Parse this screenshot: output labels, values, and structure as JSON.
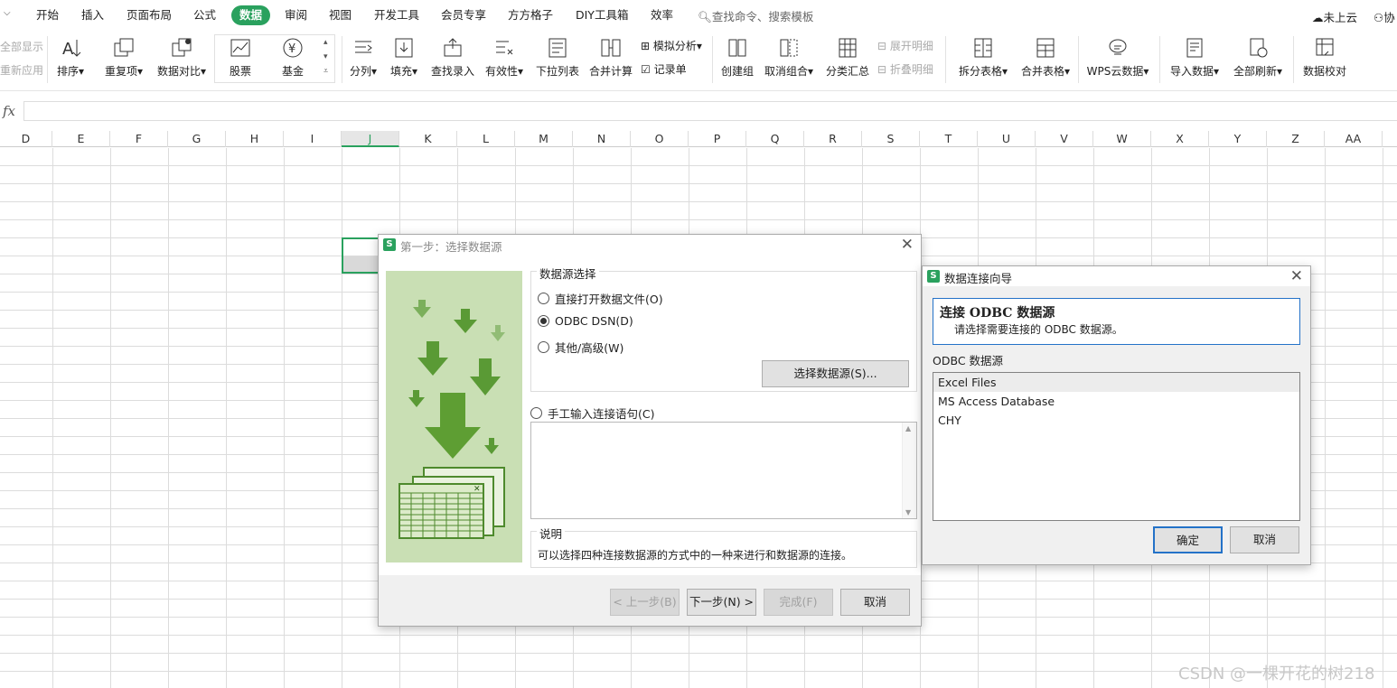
{
  "menu": {
    "tabs": [
      "开始",
      "插入",
      "页面布局",
      "公式",
      "数据",
      "审阅",
      "视图",
      "开发工具",
      "会员专享",
      "方方格子",
      "DIY工具箱",
      "效率"
    ],
    "active_tab": "数据",
    "search_placeholder": "查找命令、搜索模板",
    "cloud_label": "未上云",
    "collab_label": "协"
  },
  "ribbon": {
    "show_all": "全部显示",
    "reapply": "重新应用",
    "sort": "排序",
    "duplicates": "重复项",
    "compare": "数据对比",
    "stock": "股票",
    "fund": "基金",
    "split": "分列",
    "fill": "填充",
    "lookup": "查找录入",
    "validity": "有效性",
    "dropdown": "下拉列表",
    "merge_calc": "合并计算",
    "simulate": "模拟分析",
    "record": "记录单",
    "create_group": "创建组",
    "ungroup": "取消组合",
    "subtotal": "分类汇总",
    "expand": "展开明细",
    "collapse": "折叠明细",
    "split_table": "拆分表格",
    "merge_table": "合并表格",
    "wps_cloud": "WPS云数据",
    "import": "导入数据",
    "refresh_all": "全部刷新",
    "verify": "数据校对"
  },
  "formula_bar": {
    "fx": "fx",
    "value": ""
  },
  "columns": [
    "D",
    "E",
    "F",
    "G",
    "H",
    "I",
    "J",
    "K",
    "L",
    "M",
    "N",
    "O",
    "P",
    "Q",
    "R",
    "S",
    "T",
    "U",
    "V",
    "W",
    "X",
    "Y",
    "Z",
    "AA"
  ],
  "selected_column": "J",
  "wizard": {
    "title": "第一步：选择数据源",
    "source_group": "数据源选择",
    "options": [
      "直接打开数据文件(O)",
      "ODBC DSN(D)",
      "其他/高级(W)"
    ],
    "selected_option": 1,
    "select_source_btn": "选择数据源(S)...",
    "manual_option": "手工输入连接语句(C)",
    "desc_group": "说明",
    "desc_text": "可以选择四种连接数据源的方式中的一种来进行和数据源的连接。",
    "buttons": {
      "prev": "< 上一步(B)",
      "next": "下一步(N) >",
      "finish": "完成(F)",
      "cancel": "取消"
    }
  },
  "odbc": {
    "title": "数据连接向导",
    "heading": "连接 ODBC 数据源",
    "subheading": "请选择需要连接的 ODBC 数据源。",
    "list_label": "ODBC 数据源",
    "sources": [
      "Excel Files",
      "MS Access Database",
      "CHY"
    ],
    "selected_source": 0,
    "ok": "确定",
    "cancel": "取消"
  },
  "watermark": "CSDN @一棵开花的树218",
  "colors": {
    "accent": "#2aa15e",
    "focus": "#2472c8",
    "art_bg": "#c9dfb4",
    "art_arrow": "#5a9a35"
  }
}
